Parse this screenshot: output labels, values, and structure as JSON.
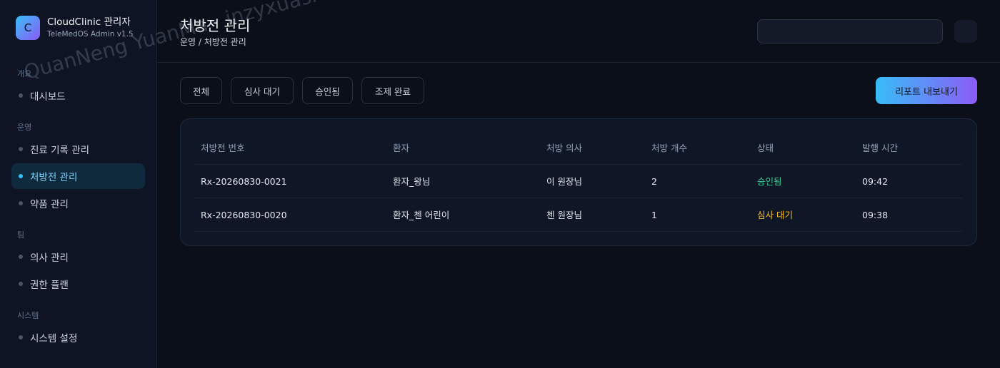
{
  "brand": {
    "logo_letter": "C",
    "title": "CloudClinic 관리자",
    "subtitle": "TeleMedOS Admin v1.5"
  },
  "sidebar": {
    "sections": [
      {
        "label": "개요"
      },
      {
        "label": "운영"
      },
      {
        "label": "팀"
      },
      {
        "label": "시스템"
      }
    ],
    "items": [
      {
        "label": "대시보드"
      },
      {
        "label": "진료 기록 관리"
      },
      {
        "label": "처방전 관리"
      },
      {
        "label": "약품 관리"
      },
      {
        "label": "의사 관리"
      },
      {
        "label": "권한 플랜"
      },
      {
        "label": "시스템 설정"
      }
    ],
    "active_item": "처방전 관리"
  },
  "header": {
    "title": "처방전 관리",
    "breadcrumb": "운영 / 처방전 관리",
    "search_value": ""
  },
  "filters": [
    "전체",
    "심사 대기",
    "승인됨",
    "조제 완료"
  ],
  "export_label": "리포트 내보내기",
  "table": {
    "columns": [
      "처방전 번호",
      "환자",
      "처방 의사",
      "처방 개수",
      "상태",
      "발행 시간"
    ],
    "rows": [
      [
        "Rx-20260830-0021",
        "환자_왕님",
        "이 원장님",
        "2",
        "승인됨",
        "09:42"
      ],
      [
        "Rx-20260830-0020",
        "환자_첸 어린이",
        "첸 원장님",
        "1",
        "심사 대기",
        "09:38"
      ]
    ]
  },
  "colors": {
    "accent": "#38bdf8",
    "accent_end": "#8b5cf6",
    "status_approved": "#34d399",
    "status_pending": "#fbbf24"
  },
  "watermark": "QuanNeng YuanMa · inzyxuashop.com"
}
